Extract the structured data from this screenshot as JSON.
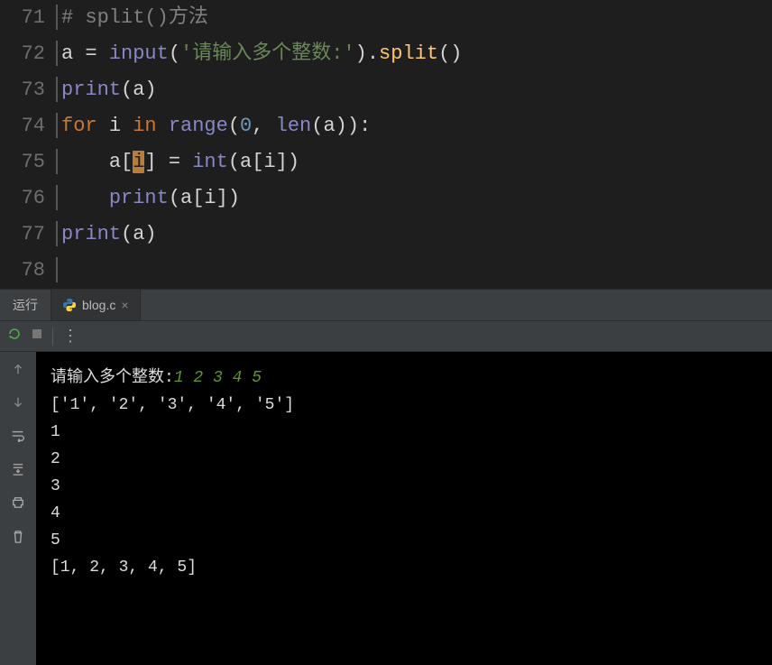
{
  "editor": {
    "lines": [
      71,
      72,
      73,
      74,
      75,
      76,
      77,
      78
    ],
    "line71": {
      "comment": "# split()方法"
    },
    "line72": {
      "a": "a",
      "eq": " = ",
      "_input": "input",
      "op1": "(",
      "str": "'请输入多个整数:'",
      "op2": ").",
      "split": "split",
      "tail": "()"
    },
    "line73": {
      "_print": "print",
      "p1": "(a)"
    },
    "line74": {
      "_for": "for ",
      "i": "i ",
      "_in": "in ",
      "range": "range",
      "p1": "(",
      "zero": "0",
      "comma": ", ",
      "len": "len",
      "p2": "(a)):"
    },
    "line75": {
      "indent": "    ",
      "pre": "a[",
      "hi": "i",
      "post": "] = ",
      "_int": "int",
      "tail": "(a[i])"
    },
    "line76": {
      "indent": "    ",
      "_print": "print",
      "tail": "(a[i])"
    },
    "line77": {
      "_print": "print",
      "tail": "(a)"
    }
  },
  "panel": {
    "run_label": "运行",
    "tab_label": "blog.c"
  },
  "terminal": {
    "prompt_prefix": "请输入多个整数:",
    "user_input": "1 2 3 4 5",
    "out1": "['1', '2', '3', '4', '5']",
    "out2": "1",
    "out3": "2",
    "out4": "3",
    "out5": "4",
    "out6": "5",
    "out7": "[1, 2, 3, 4, 5]"
  }
}
